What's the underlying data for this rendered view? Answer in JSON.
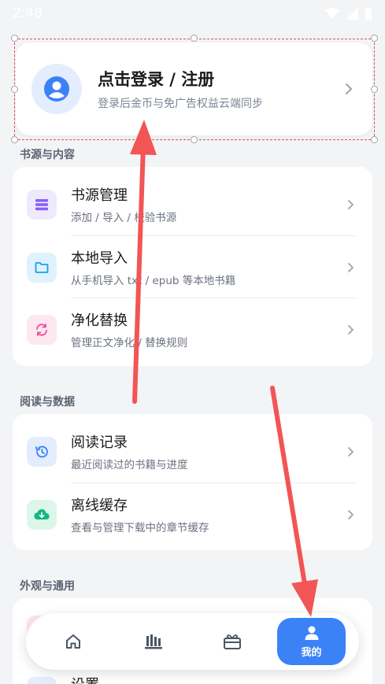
{
  "status_bar": {
    "time": "2:48"
  },
  "login": {
    "title": "点击登录 / 注册",
    "subtitle": "登录后金币与免广告权益云端同步"
  },
  "sections": [
    {
      "title": "书源与内容",
      "items": [
        {
          "title": "书源管理",
          "subtitle": "添加 / 导入 / 校验书源",
          "icon": "list-icon",
          "color": "#8b5cf6",
          "bg": "#efe9fe"
        },
        {
          "title": "本地导入",
          "subtitle": "从手机导入 txt / epub 等本地书籍",
          "icon": "folder-icon",
          "color": "#0ea5e9",
          "bg": "#e0f2fe"
        },
        {
          "title": "净化替换",
          "subtitle": "管理正文净化 / 替换规则",
          "icon": "refresh-icon",
          "color": "#ec4899",
          "bg": "#fde7f1"
        }
      ]
    },
    {
      "title": "阅读与数据",
      "items": [
        {
          "title": "阅读记录",
          "subtitle": "最近阅读过的书籍与进度",
          "icon": "history-icon",
          "color": "#3b82f6",
          "bg": "#e3edfd"
        },
        {
          "title": "离线缓存",
          "subtitle": "查看与管理下载中的章节缓存",
          "icon": "cloud-download-icon",
          "color": "#10b981",
          "bg": "#dcf7ea"
        }
      ]
    },
    {
      "title": "外观与通用",
      "items": [
        {
          "title": "设置"
        }
      ]
    }
  ],
  "bottom_nav": {
    "items": [
      {
        "icon": "home-icon"
      },
      {
        "icon": "bookshelf-icon"
      },
      {
        "icon": "gift-icon"
      },
      {
        "icon": "user-icon",
        "label": "我的"
      }
    ]
  },
  "colors": {
    "accent": "#3b82f6",
    "annotation": "#f25555"
  }
}
